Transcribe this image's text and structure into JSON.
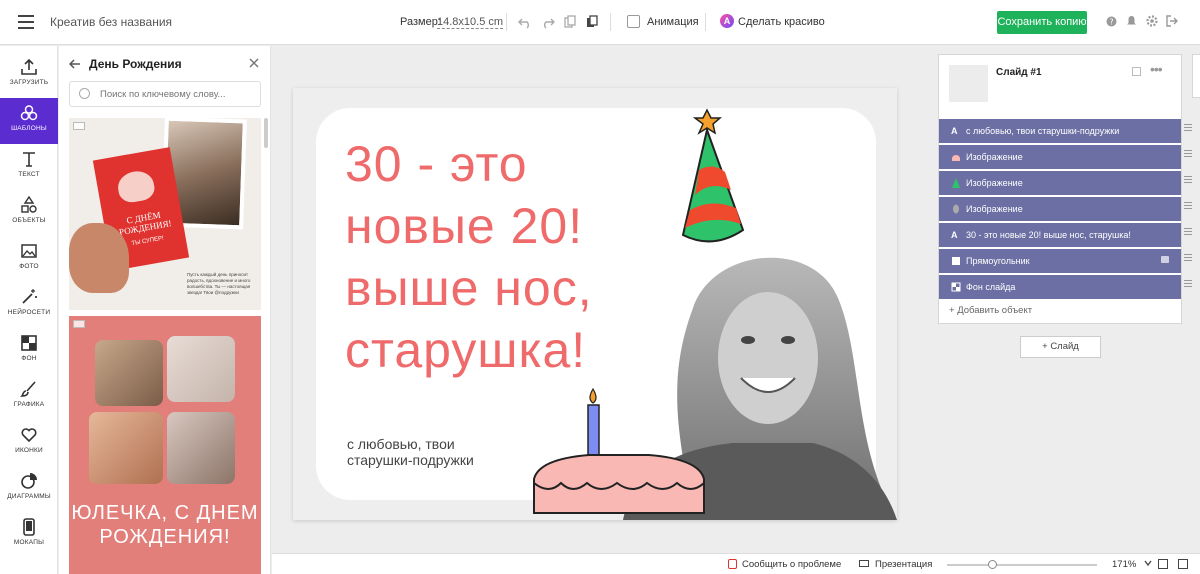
{
  "header": {
    "doc_title": "Креатив без названия",
    "size_label": "Размер:",
    "size_value": "14.8x10.5 cm",
    "animation_label": "Анимация",
    "magic_label": "Сделать красиво",
    "save_label": "Сохранить копию"
  },
  "rail": {
    "items": [
      {
        "label": "ЗАГРУЗИТЬ",
        "icon": "upload-icon"
      },
      {
        "label": "ШАБЛОНЫ",
        "icon": "templates-icon"
      },
      {
        "label": "ТЕКСТ",
        "icon": "text-icon"
      },
      {
        "label": "ОБЪЕКТЫ",
        "icon": "shapes-icon"
      },
      {
        "label": "ФОТО",
        "icon": "photo-icon"
      },
      {
        "label": "НЕЙРОСЕТИ",
        "icon": "magic-wand-icon"
      },
      {
        "label": "ФОН",
        "icon": "background-icon"
      },
      {
        "label": "ГРАФИКА",
        "icon": "brush-icon"
      },
      {
        "label": "ИКОНКИ",
        "icon": "heart-icon"
      },
      {
        "label": "ДИАГРАММЫ",
        "icon": "pie-chart-icon"
      },
      {
        "label": "МОКАПЫ",
        "icon": "phone-icon"
      }
    ]
  },
  "panel": {
    "title": "День Рождения",
    "search_placeholder": "Поиск по ключевому слову...",
    "template1": {
      "card_text": "С ДНЁМ РОЖДЕНИЯ!",
      "card_sub": "ТЫ СУПЕР!",
      "caption": "Пусть каждый день приносит радость, вдохновение и много волшебства. Ты — настоящая звезда! Твои @подружки"
    },
    "template2": {
      "text": "ЮЛЕЧКА, С ДНЕМ РОЖДЕНИЯ!"
    }
  },
  "canvas": {
    "headline": [
      "30 - это",
      "новые 20!",
      "выше нос,",
      "старушка!"
    ],
    "subline": [
      "с любовью, твои",
      "старушки-подружки"
    ]
  },
  "layers": {
    "slide_name": "Слайд #1",
    "rows": [
      {
        "icon": "A",
        "label": "с любовью, твои старушки-подружки",
        "locked": false
      },
      {
        "icon": "img",
        "label": "Изображение",
        "locked": false
      },
      {
        "icon": "img",
        "label": "Изображение",
        "locked": false
      },
      {
        "icon": "img",
        "label": "Изображение",
        "locked": false
      },
      {
        "icon": "A",
        "label": "30 - это новые 20! выше нос, старушка!",
        "locked": false
      },
      {
        "icon": "rect",
        "label": "Прямоугольник",
        "locked": true
      },
      {
        "icon": "bg",
        "label": "Фон слайда",
        "locked": false
      }
    ],
    "add_object": "Добавить объект",
    "add_slide": "Слайд"
  },
  "footer": {
    "report": "Сообщить о проблеме",
    "present": "Презентация",
    "zoom": "171%",
    "zoom_fraction": 0.3
  },
  "colors": {
    "accent": "#5b2ccf",
    "save": "#1eb35a",
    "layer_row": "#6b6fa3",
    "headline": "#ef6a6a"
  }
}
